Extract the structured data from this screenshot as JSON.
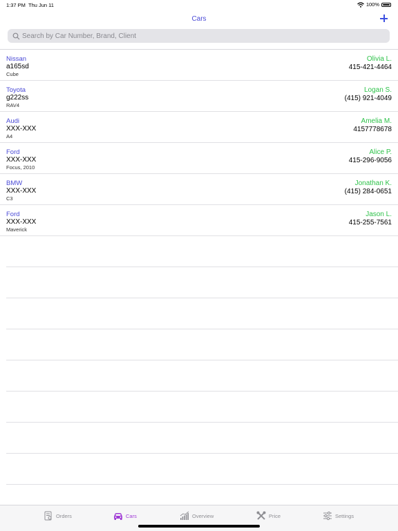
{
  "status_bar": {
    "time": "1:37 PM",
    "date": "Thu Jun 11",
    "battery": "100%"
  },
  "nav": {
    "title": "Cars"
  },
  "search": {
    "placeholder": "Search by Car Number, Brand, Client"
  },
  "cars": [
    {
      "brand": "Nissan",
      "plate": "a165sd",
      "model": "Cube",
      "client": "Olivia L.",
      "phone": "415-421-4464"
    },
    {
      "brand": "Toyota",
      "plate": "g222ss",
      "model": "RAV4",
      "client": "Logan S.",
      "phone": "(415) 921-4049"
    },
    {
      "brand": "Audi",
      "plate": "XXX-XXX",
      "model": "A4",
      "client": "Amelia M.",
      "phone": "4157778678"
    },
    {
      "brand": "Ford",
      "plate": "XXX-XXX",
      "model": "Focus, 2010",
      "client": "Alice P.",
      "phone": "415-296-9056"
    },
    {
      "brand": "BMW",
      "plate": "XXX-XXX",
      "model": "C3",
      "client": "Jonathan K.",
      "phone": "(415) 284-0651"
    },
    {
      "brand": "Ford",
      "plate": "XXX-XXX",
      "model": "Maverick",
      "client": "Jason L.",
      "phone": "415-255-7561"
    }
  ],
  "tabs": [
    {
      "label": "Orders",
      "icon": "orders-icon"
    },
    {
      "label": "Cars",
      "icon": "car-icon"
    },
    {
      "label": "Overview",
      "icon": "chart-icon"
    },
    {
      "label": "Price",
      "icon": "tools-icon"
    },
    {
      "label": "Settings",
      "icon": "sliders-icon"
    }
  ],
  "colors": {
    "accent": "#4a4ad6",
    "client": "#2ec24a",
    "active_tab": "#a03bd6"
  }
}
